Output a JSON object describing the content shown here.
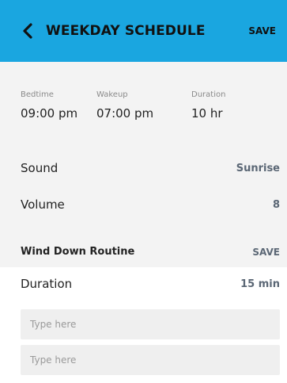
{
  "header": {
    "title": "WEEKDAY SCHEDULE",
    "save_label": "SAVE",
    "back_icon": "chevron-left-icon"
  },
  "times": [
    {
      "label": "Bedtime",
      "value": "09:00 pm"
    },
    {
      "label": "Wakeup",
      "value": "07:00 pm"
    },
    {
      "label": "Duration",
      "value": "10 hr"
    }
  ],
  "settings": {
    "sound": {
      "label": "Sound",
      "value": "Sunrise"
    },
    "volume": {
      "label": "Volume",
      "value": "8"
    }
  },
  "wind_down": {
    "title": "Wind Down Routine",
    "save_label": "SAVE",
    "duration": {
      "label": "Duration",
      "value": "15 min"
    },
    "inputs": [
      {
        "placeholder": "Type here"
      },
      {
        "placeholder": "Type here"
      }
    ]
  },
  "colors": {
    "header_bg": "#1aa6e0",
    "accent_text": "#5b6775",
    "page_bg": "#f3f3f3"
  }
}
